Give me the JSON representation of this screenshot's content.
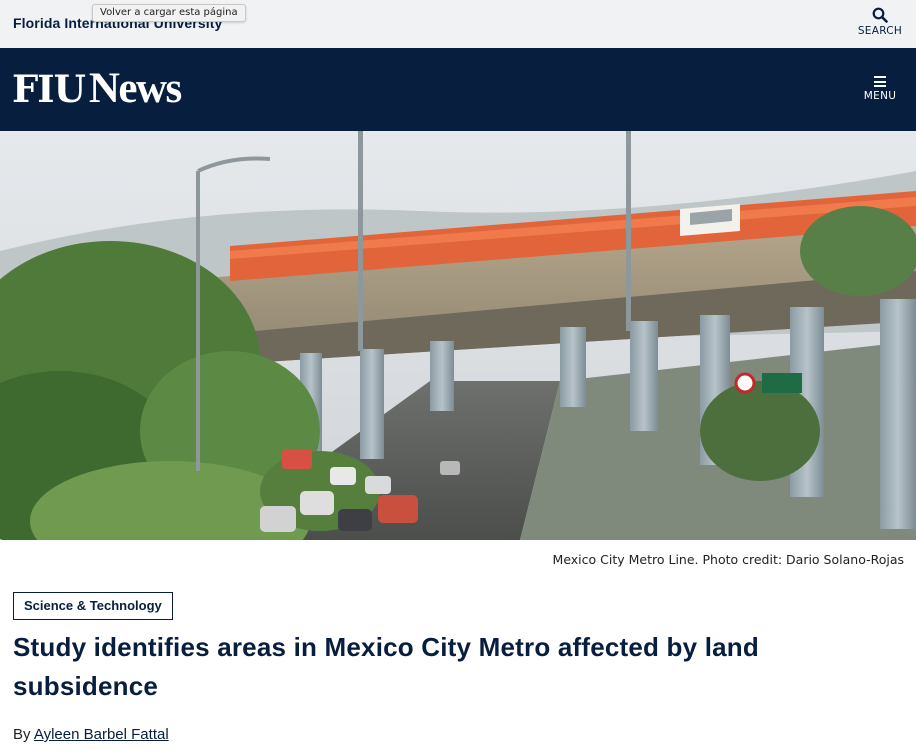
{
  "top_bar": {
    "university_name": "Florida International University",
    "tooltip": "Volver a cargar esta página",
    "search_label": "SEARCH"
  },
  "nav": {
    "logo_fiu": "FIU",
    "logo_news": "News",
    "menu_label": "MENU"
  },
  "hero": {
    "caption": "Mexico City Metro Line. Photo credit: Dario Solano-Rojas"
  },
  "article": {
    "category": "Science & Technology",
    "headline": "Study identifies areas in Mexico City Metro affected by land subsidence",
    "byline_prefix": "By",
    "author": "Ayleen Barbel Fattal"
  },
  "colors": {
    "brand_navy": "#081e3f",
    "top_bar_bg": "#f0f2f4",
    "train_orange": "#e2643a"
  },
  "icons": {
    "search": "search-icon",
    "menu": "hamburger-icon"
  }
}
